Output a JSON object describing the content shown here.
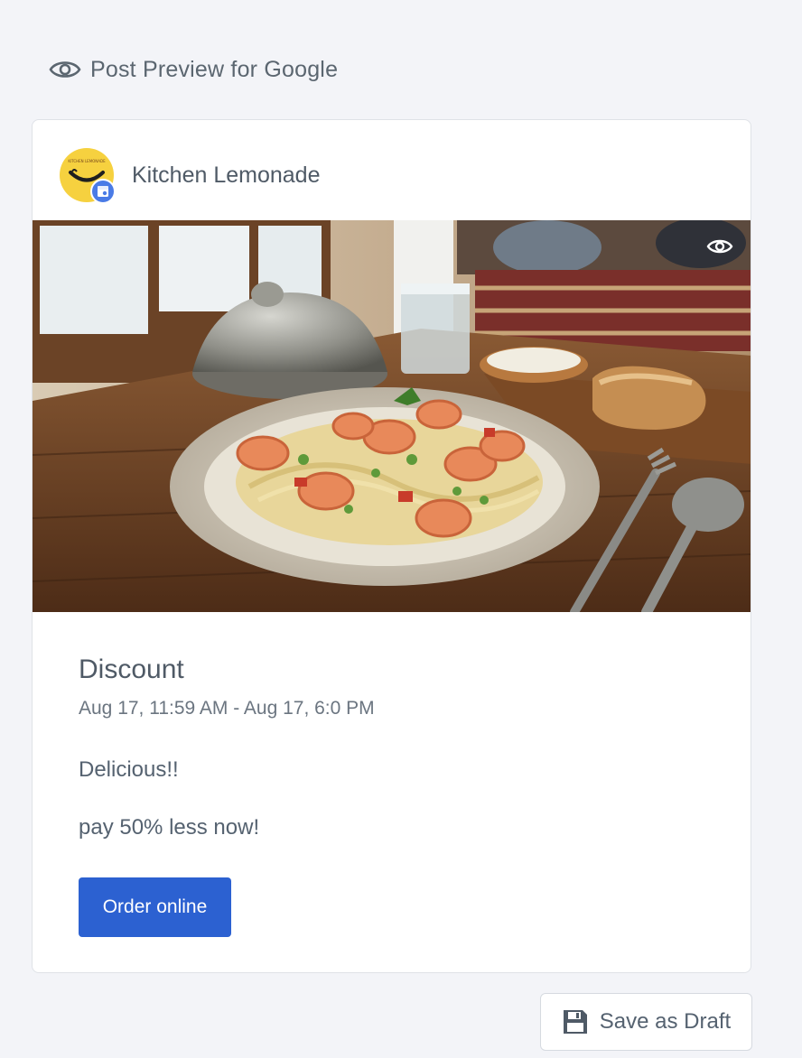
{
  "header": {
    "icon": "eye-icon",
    "title": "Post Preview for Google"
  },
  "business": {
    "name": "Kitchen Lemonade",
    "avatar_icon": "smiley-logo-icon",
    "badge_icon": "google-business-icon",
    "logo_small_text": "KITCHEN LEMONADE"
  },
  "image": {
    "description_icon": "photo-shrimp-pasta",
    "toggle_icon": "eye-icon"
  },
  "post": {
    "title": "Discount",
    "date_range": "Aug 17, 11:59 AM - Aug 17, 6:0 PM",
    "body_line1": "Delicious!!",
    "body_line2": "pay 50% less now!",
    "cta_label": "Order online"
  },
  "footer": {
    "save_draft_label": "Save as Draft",
    "save_draft_icon": "save-disk-icon"
  },
  "colors": {
    "accent": "#2c61d1",
    "background": "#f3f4f8",
    "avatar_yellow": "#f6d13f",
    "badge_blue": "#4a7be6"
  }
}
